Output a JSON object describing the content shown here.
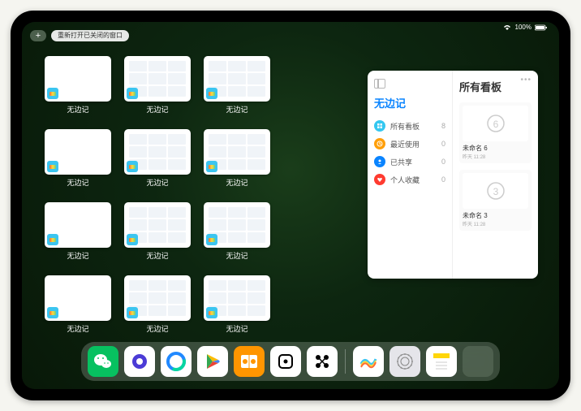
{
  "status": {
    "battery": "100%"
  },
  "topbar": {
    "plus_label": "+",
    "reopen_label": "重新打开已关闭的窗口"
  },
  "windows": [
    {
      "label": "无边记",
      "has_content": false
    },
    {
      "label": "无边记",
      "has_content": true
    },
    {
      "label": "无边记",
      "has_content": true
    },
    {
      "label": "无边记",
      "has_content": false
    },
    {
      "label": "无边记",
      "has_content": true
    },
    {
      "label": "无边记",
      "has_content": true
    },
    {
      "label": "无边记",
      "has_content": false
    },
    {
      "label": "无边记",
      "has_content": true
    },
    {
      "label": "无边记",
      "has_content": true
    },
    {
      "label": "无边记",
      "has_content": false
    },
    {
      "label": "无边记",
      "has_content": true
    },
    {
      "label": "无边记",
      "has_content": true
    }
  ],
  "sidepanel": {
    "left_title": "无边记",
    "right_title": "所有看板",
    "items": [
      {
        "icon": "grid",
        "color": "#34c7f0",
        "label": "所有看板",
        "count": 8
      },
      {
        "icon": "clock",
        "color": "#ff9f0a",
        "label": "最近使用",
        "count": 0
      },
      {
        "icon": "share",
        "color": "#0a84ff",
        "label": "已共享",
        "count": 0
      },
      {
        "icon": "heart",
        "color": "#ff3b30",
        "label": "个人收藏",
        "count": 0
      }
    ],
    "boards": [
      {
        "title": "未命名 6",
        "sub": "昨天 11:28",
        "sketch": "6"
      },
      {
        "title": "未命名 3",
        "sub": "昨天 11:28",
        "sketch": "3"
      }
    ]
  },
  "dock": {
    "apps": [
      {
        "name": "wechat",
        "bg": "#07c160"
      },
      {
        "name": "quark",
        "bg": "#ffffff"
      },
      {
        "name": "qqbrowser",
        "bg": "#ffffff"
      },
      {
        "name": "play",
        "bg": "#ffffff"
      },
      {
        "name": "books",
        "bg": "#ff9500"
      },
      {
        "name": "dice",
        "bg": "#ffffff"
      },
      {
        "name": "connect",
        "bg": "#ffffff"
      },
      {
        "name": "freeform",
        "bg": "#ffffff"
      },
      {
        "name": "settings",
        "bg": "#e5e5ea"
      },
      {
        "name": "notes",
        "bg": "#ffffff"
      }
    ]
  }
}
